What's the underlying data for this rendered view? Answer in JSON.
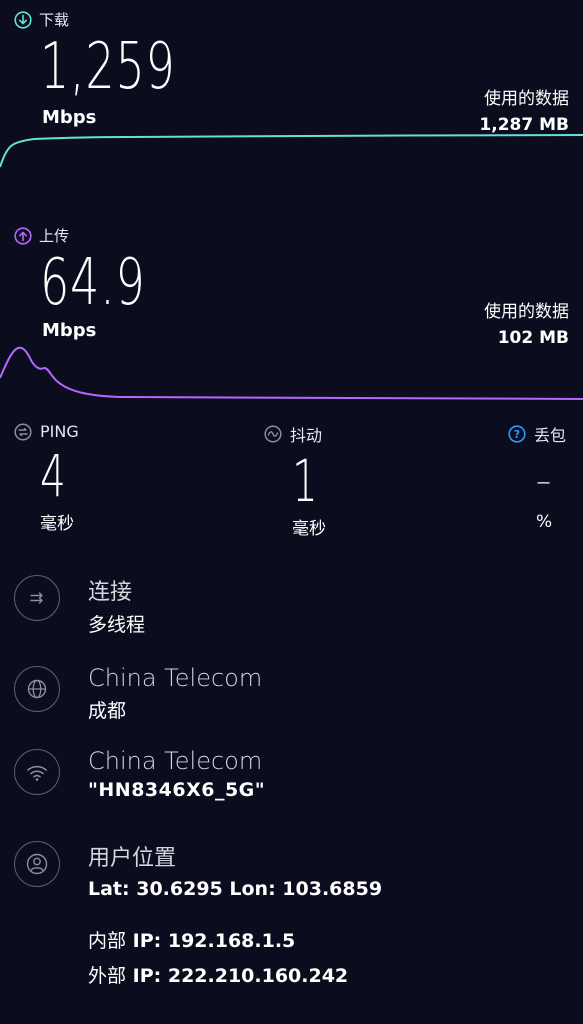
{
  "download": {
    "label": "下载",
    "value": "1,259",
    "unit": "Mbps",
    "data_used_label": "使用的数据",
    "data_used": "1,287 MB",
    "color": "#5ee3d4"
  },
  "upload": {
    "label": "上传",
    "value": "64.9",
    "unit": "Mbps",
    "data_used_label": "使用的数据",
    "data_used": "102 MB",
    "color": "#b467ff"
  },
  "ping": {
    "label": "PING",
    "value": "4",
    "unit": "毫秒"
  },
  "jitter": {
    "label": "抖动",
    "value": "1",
    "unit": "毫秒"
  },
  "packet_loss": {
    "label": "丢包",
    "value": "–",
    "unit": "%"
  },
  "connection": {
    "title": "连接",
    "value": "多线程"
  },
  "isp": {
    "title": "China Telecom",
    "value": "成都"
  },
  "network": {
    "title": "China Telecom",
    "value": "\"HN8346X6_5G\""
  },
  "location": {
    "title": "用户位置",
    "coords": "Lat: 30.6295 Lon: 103.6859",
    "internal_ip_label": "内部",
    "internal_ip": "IP: 192.168.1.5",
    "external_ip_label": "外部",
    "external_ip": "IP: 222.210.160.242"
  },
  "colors": {
    "background": "#0b0d1f",
    "download": "#5ee3d4",
    "upload": "#b467ff",
    "help": "#2f9bff"
  }
}
